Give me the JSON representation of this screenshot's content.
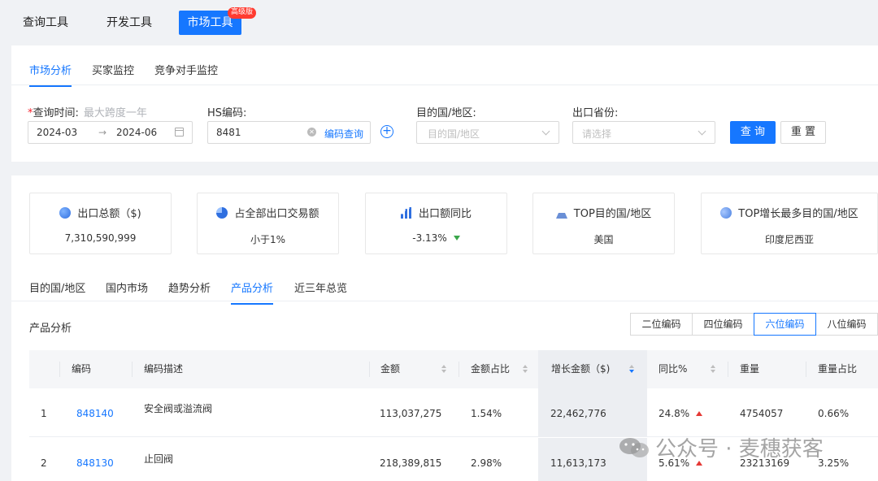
{
  "top_tabs": [
    {
      "label": "查询工具"
    },
    {
      "label": "开发工具"
    },
    {
      "label": "市场工具",
      "badge": "高级版"
    }
  ],
  "sub_tabs": [
    {
      "label": "市场分析"
    },
    {
      "label": "买家监控"
    },
    {
      "label": "竞争对手监控"
    }
  ],
  "filters": {
    "time_label": "查询时间:",
    "time_hint": "最大跨度一年",
    "time_start": "2024-03",
    "time_sep": "→",
    "time_end": "2024-06",
    "hs_label": "HS编码:",
    "hs_value": "8481",
    "hs_query": "编码查询",
    "dest_label": "目的国/地区:",
    "dest_placeholder": "目的国/地区",
    "province_label": "出口省份:",
    "province_placeholder": "请选择",
    "query_button": "查 询",
    "reset_button": "重 置"
  },
  "kpis": [
    {
      "title": "出口总额（$)",
      "value": "7,310,590,999",
      "icon": "globe-icon"
    },
    {
      "title": "占全部出口交易额",
      "value": "小于1%",
      "icon": "pie-chart-icon"
    },
    {
      "title": "出口额同比",
      "value": "-3.13%",
      "icon": "bar-chart-icon",
      "trend": "down"
    },
    {
      "title": "TOP目的国/地区",
      "value": "美国",
      "icon": "basket-icon"
    },
    {
      "title": "TOP增长最多目的国/地区",
      "value": "印度尼西亚",
      "icon": "earth-icon"
    }
  ],
  "analysis_tabs": [
    {
      "label": "目的国/地区"
    },
    {
      "label": "国内市场"
    },
    {
      "label": "趋势分析"
    },
    {
      "label": "产品分析"
    },
    {
      "label": "近三年总览"
    }
  ],
  "product_section": {
    "title": "产品分析",
    "segments": [
      {
        "label": "二位编码"
      },
      {
        "label": "四位编码"
      },
      {
        "label": "六位编码"
      },
      {
        "label": "八位编码"
      }
    ]
  },
  "table": {
    "headers": [
      "编码",
      "编码描述",
      "金额",
      "金额占比",
      "增长金额（$)",
      "同比%",
      "重量",
      "重量占比"
    ],
    "rows": [
      {
        "index": "1",
        "code": "848140",
        "desc": "安全阀或溢流阀",
        "amount": "113,037,275",
        "share": "1.54%",
        "growth": "22,462,776",
        "yoy": "24.8%",
        "weight": "4754057",
        "weight_share": "0.66%"
      },
      {
        "index": "2",
        "code": "848130",
        "desc": "止回阀",
        "amount": "218,389,815",
        "share": "2.98%",
        "growth": "11,613,173",
        "yoy": "5.61%",
        "weight": "23213169",
        "weight_share": "3.25%"
      }
    ]
  },
  "watermark": "公众号 · 麦穗获客",
  "colors": {
    "primary": "#1677ff",
    "up": "#e53935",
    "down": "#3aa64a",
    "badge": "#ff3b30"
  }
}
